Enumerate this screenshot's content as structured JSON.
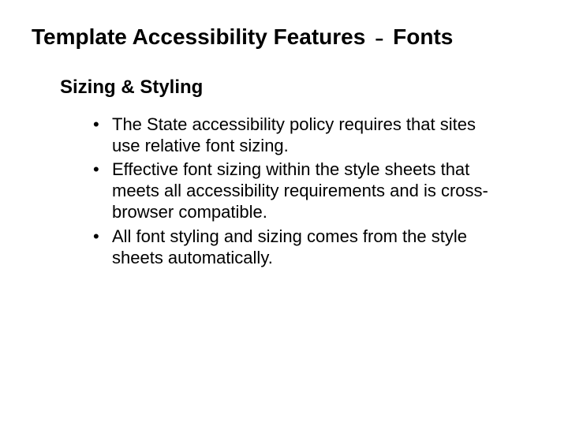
{
  "title": {
    "part1": "Template Accessibility Features",
    "sep": "-",
    "part2": "Fonts"
  },
  "subtitle": "Sizing & Styling",
  "bullets": [
    "The State accessibility policy requires that sites use relative font sizing.",
    "Effective font sizing within the style sheets that meets all accessibility requirements and is cross-browser compatible.",
    "All font styling and sizing comes from the style sheets automatically."
  ]
}
